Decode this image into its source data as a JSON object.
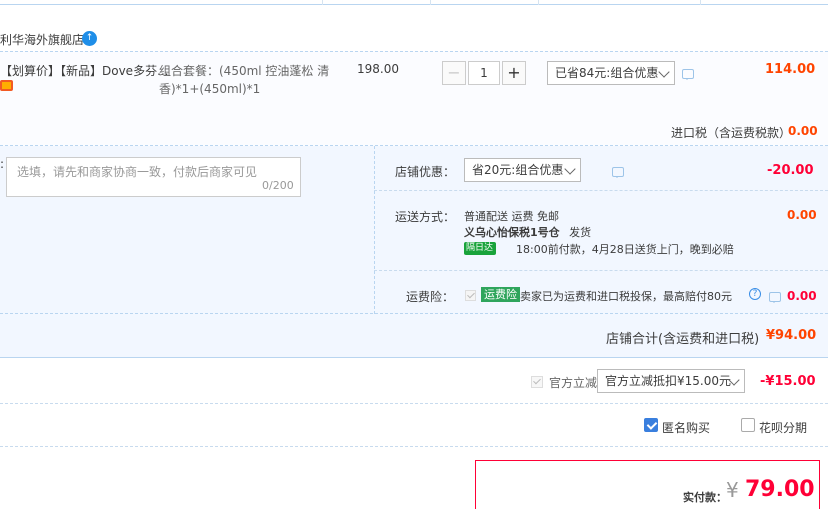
{
  "store": {
    "name": "利华海外旗舰店",
    "badge": "↑"
  },
  "item": {
    "title": "【划算价】【新品】Dove多芬...",
    "sku_line1": "组合套餐：(450ml 控油蓬松 清",
    "sku_line2": "香)*1+(450ml)*1",
    "unit_price": "198.00",
    "quantity": "1",
    "qty_minus": "−",
    "qty_plus": "+",
    "discount_selected": "已省84元:组合优惠",
    "total": "114.00"
  },
  "tax": {
    "label": "进口税（含运费税款）",
    "value": "0.00"
  },
  "message": {
    "colon": ":",
    "placeholder": "选填，请先和商家协商一致，付款后商家可见",
    "count": "0/200"
  },
  "shop_discount": {
    "label": "店铺优惠：",
    "selected": "省20元:组合优惠",
    "value": "-20.00"
  },
  "shipping": {
    "label": "运送方式：",
    "line1": "普通配送 运费 免邮",
    "warehouse": "义乌心怡保税1号仓",
    "ship_word": "发货",
    "badge": "隔日达",
    "line3": "18:00前付款，4月28日送货上门，晚到必赔",
    "value": "0.00"
  },
  "insurance": {
    "label": "运费险：",
    "badge": "运费险",
    "text": "卖家已为运费和进口税投保，最高赔付80元",
    "help": "?",
    "value": "0.00"
  },
  "store_total": {
    "label": "店铺合计(含运费和进口税)",
    "value": "¥94.00"
  },
  "official": {
    "label": "官方立减",
    "selected": "官方立减抵扣¥15.00元",
    "value": "-¥15.00"
  },
  "options": {
    "anonymous": "匿名购买",
    "huabei": "花呗分期"
  },
  "payment": {
    "label": "实付款：",
    "symbol": "¥",
    "value": "79.00"
  },
  "colors": {
    "accent_red": "#ff0036",
    "price_orange": "#ff4400",
    "border_blue": "#b9d5f0",
    "panel_bg": "#f2f7ff"
  }
}
